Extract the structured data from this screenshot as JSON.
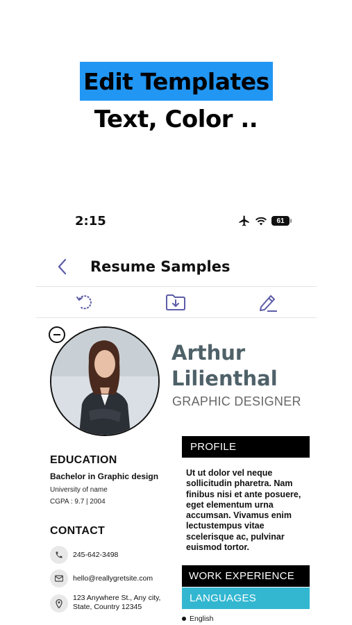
{
  "promo": {
    "title": "Edit Templates",
    "subtitle": "Text, Color .."
  },
  "status_bar": {
    "time": "2:15",
    "battery": "61"
  },
  "nav": {
    "title": "Resume Samples"
  },
  "toolbar": {
    "icons": [
      "refresh-icon",
      "download-folder-icon",
      "edit-pencil-icon"
    ]
  },
  "resume": {
    "first_name": "Arthur",
    "last_name": "Lilienthal",
    "role": "GRAPHIC DESIGNER",
    "education": {
      "heading": "EDUCATION",
      "degree": "Bachelor in Graphic design",
      "university": "University of name",
      "cgpa": "CGPA : 9.7 | 2004"
    },
    "contact": {
      "heading": "CONTACT",
      "phone": "245-642-3498",
      "email": "hello@reallygretsite.com",
      "address_line1": "123 Anywhere St., Any city,",
      "address_line2": "State, Country 12345"
    },
    "profile": {
      "heading": "PROFILE",
      "text": "Ut ut dolor vel neque sollicitudin pharetra. Nam finibus nisi et ante posuere, eget elementum urna accumsan. Vivamus enim lectustempus vitae scelerisque ac, pulvinar euismod tortor."
    },
    "work_experience": {
      "heading": "WORK EXPERIENCE"
    },
    "languages": {
      "heading": "LANGUAGES",
      "items": [
        "English"
      ]
    }
  },
  "colors": {
    "promo_highlight": "#2196f3",
    "accent": "#5c5ca8",
    "name": "#4f6168",
    "languages_bar": "#33b7d1"
  }
}
